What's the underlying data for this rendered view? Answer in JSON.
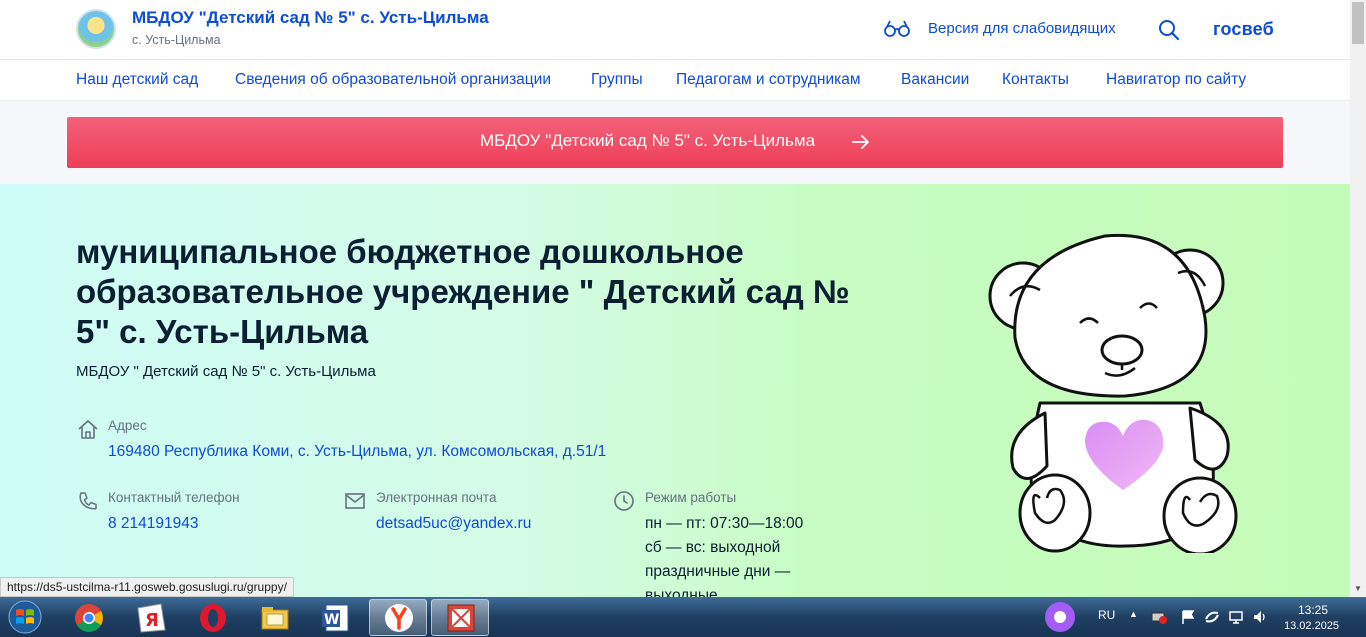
{
  "header": {
    "org_title": "МБДОУ \"Детский сад № 5\" с. Усть-Цильма",
    "org_location": "с. Усть-Цильма",
    "vision_link": "Версия для слабовидящих",
    "brand": "госвеб"
  },
  "nav": {
    "items": [
      "Наш детский сад",
      "Сведения об образовательной организации",
      "Группы",
      "Педагогам и сотрудникам",
      "Вакансии",
      "Контакты",
      "Навигатор по сайту"
    ]
  },
  "banner": {
    "text": "МБДОУ \"Детский сад № 5\" с. Усть-Цильма"
  },
  "hero": {
    "title": "муниципальное бюджетное дошкольное образовательное учреждение \" Детский сад № 5\" с. Усть-Цильма",
    "subtitle": "МБДОУ \" Детский сад № 5\" с. Усть-Цильма"
  },
  "contacts": {
    "address_label": "Адрес",
    "address_value": "169480 Республика Коми, с. Усть-Цильма, ул. Комсомольская, д.51/1",
    "phone_label": "Контактный телефон",
    "phone_value": "8 214191943",
    "email_label": "Электронная почта",
    "email_value": "detsad5uc@yandex.ru",
    "hours_label": "Режим работы",
    "hours_lines": [
      "пн — пт: 07:30—18:00",
      "сб — вс: выходной",
      "праздничные дни —",
      "выходные"
    ]
  },
  "status_url": "https://ds5-ustcilma-r11.gosweb.gosuslugi.ru/gruppy/",
  "taskbar": {
    "language": "RU",
    "time": "13:25",
    "date": "13.02.2025"
  },
  "colors": {
    "link": "#0d4cd3",
    "banner": "#ee3f58",
    "text": "#0b1f33"
  }
}
